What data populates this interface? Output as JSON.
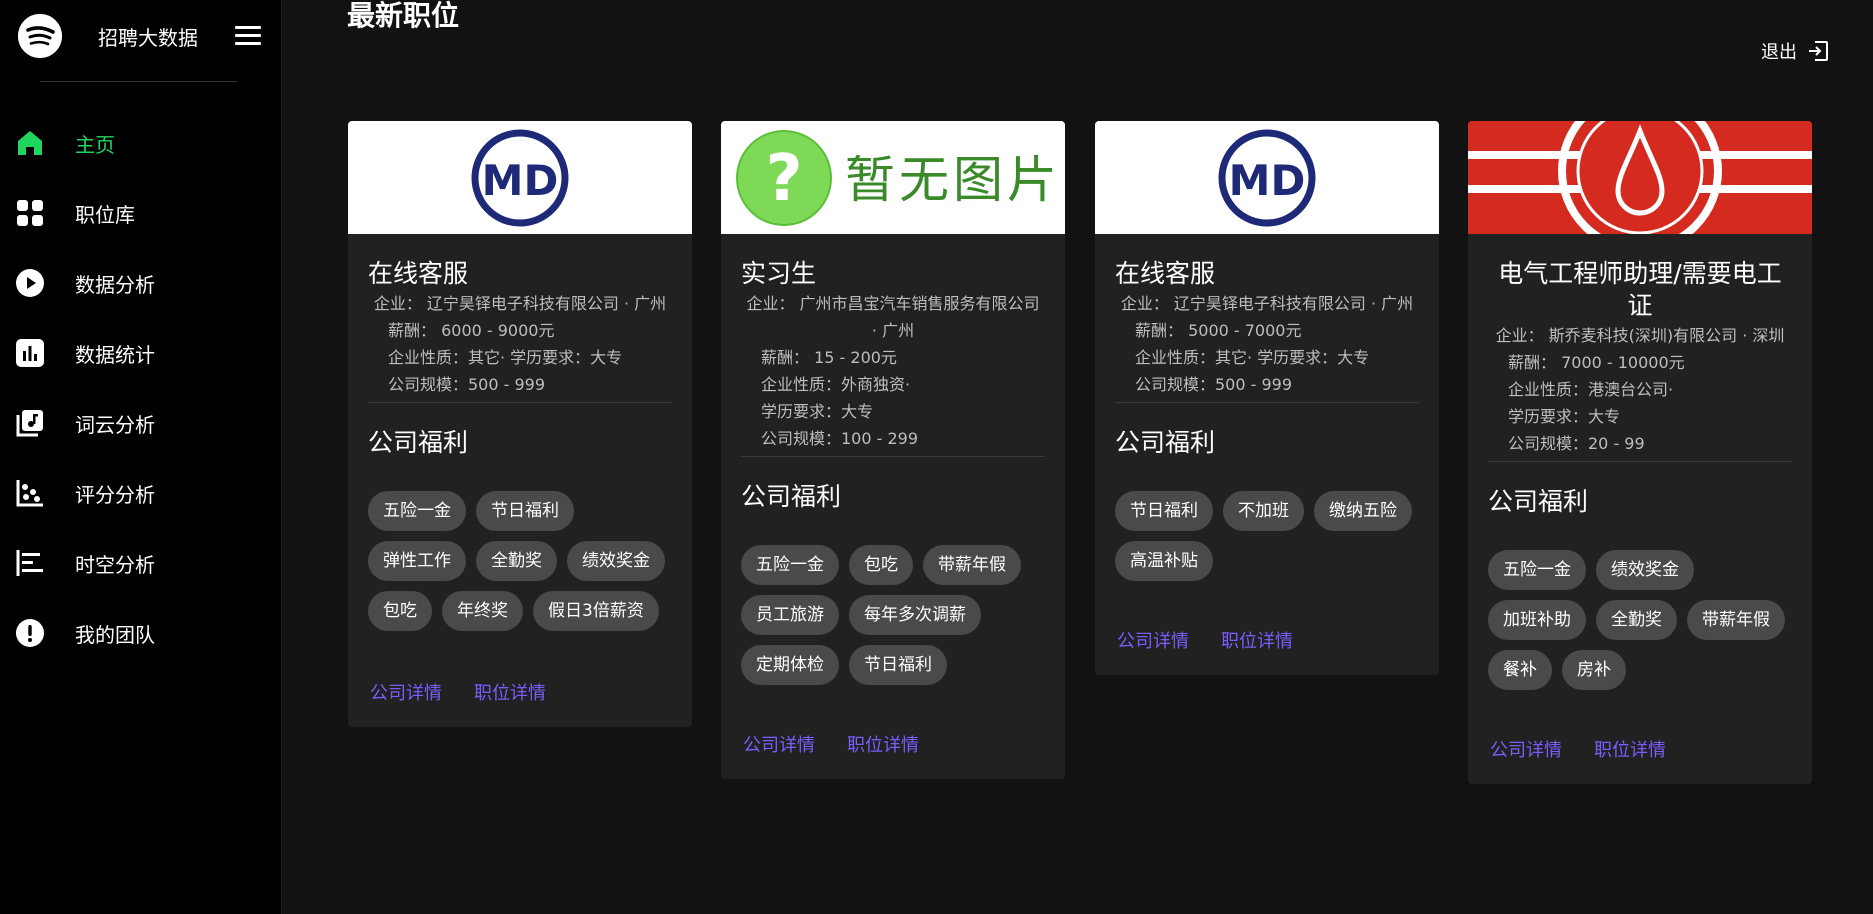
{
  "brand": {
    "title": "招聘大数据"
  },
  "nav": [
    {
      "label": "主页",
      "icon": "home-icon",
      "active": true
    },
    {
      "label": "职位库",
      "icon": "grid-icon"
    },
    {
      "label": "数据分析",
      "icon": "play-icon"
    },
    {
      "label": "数据统计",
      "icon": "bar-chart-icon"
    },
    {
      "label": "词云分析",
      "icon": "music-library-icon"
    },
    {
      "label": "评分分析",
      "icon": "scatter-icon"
    },
    {
      "label": "时空分析",
      "icon": "timeline-icon"
    },
    {
      "label": "我的团队",
      "icon": "info-icon"
    }
  ],
  "header": {
    "title": "最新职位",
    "logout": "退出"
  },
  "accent_color": "#1ed760",
  "link_color": "#7c5cff",
  "cards": [
    {
      "image": "md-logo",
      "title": "在线客服",
      "company": "企业：  辽宁昊铎电子科技有限公司 · 广州",
      "salary": "薪酬：  6000 - 9000元",
      "nature_edu": "企业性质：其它·     学历要求：大专",
      "scale": "公司规模：500 - 999",
      "benefit_title": "公司福利",
      "tags": [
        "五险一金",
        "节日福利",
        "弹性工作",
        "全勤奖",
        "绩效奖金",
        "包吃",
        "年终奖",
        "假日3倍薪资"
      ],
      "company_link": "公司详情",
      "job_link": "职位详情"
    },
    {
      "image": "no-image",
      "image_text": "暂无图片",
      "title": "实习生",
      "company": "企业：  广州市昌宝汽车销售服务有限公司 · 广州",
      "salary": "薪酬：  15 - 200元",
      "nature": "企业性质：外商独资·",
      "edu": "学历要求：大专",
      "scale": "公司规模：100 - 299",
      "benefit_title": "公司福利",
      "tags": [
        "五险一金",
        "包吃",
        "带薪年假",
        "员工旅游",
        "每年多次调薪",
        "定期体检",
        "节日福利"
      ],
      "company_link": "公司详情",
      "job_link": "职位详情"
    },
    {
      "image": "md-logo",
      "title": "在线客服",
      "company": "企业：  辽宁昊铎电子科技有限公司 · 广州",
      "salary": "薪酬：  5000 - 7000元",
      "nature_edu": "企业性质：其它·     学历要求：大专",
      "scale": "公司规模：500 - 999",
      "benefit_title": "公司福利",
      "tags": [
        "节日福利",
        "不加班",
        "缴纳五险",
        "高温补贴"
      ],
      "company_link": "公司详情",
      "job_link": "职位详情"
    },
    {
      "image": "red-logo",
      "title": "电气工程师助理/需要电工证",
      "company": "企业：  斯乔麦科技(深圳)有限公司 · 深圳",
      "salary": "薪酬：  7000 - 10000元",
      "nature": "企业性质：港澳台公司·",
      "edu": "学历要求：大专",
      "scale": "公司规模：20 - 99",
      "benefit_title": "公司福利",
      "tags": [
        "五险一金",
        "绩效奖金",
        "加班补助",
        "全勤奖",
        "带薪年假",
        "餐补",
        "房补"
      ],
      "company_link": "公司详情",
      "job_link": "职位详情"
    }
  ]
}
